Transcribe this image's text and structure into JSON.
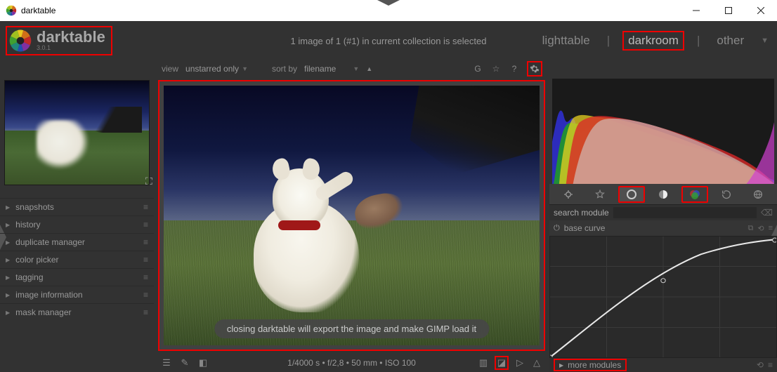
{
  "titlebar": {
    "title": "darktable"
  },
  "brand": {
    "name": "darktable",
    "version": "3.0.1"
  },
  "top": {
    "status": "1 image of 1 (#1) in current collection is selected",
    "nav": {
      "lighttable": "lighttable",
      "darkroom": "darkroom",
      "other": "other"
    }
  },
  "filter": {
    "view_label": "view",
    "view_value": "unstarred only",
    "sort_label": "sort by",
    "sort_value": "filename"
  },
  "left_modules": [
    "snapshots",
    "history",
    "duplicate manager",
    "color picker",
    "tagging",
    "image information",
    "mask manager"
  ],
  "toast": "closing darktable will export the image and make GIMP load it",
  "status_info": "1/4000 s • f/2,8 • 50 mm • ISO 100",
  "search": {
    "label": "search module",
    "placeholder": ""
  },
  "module": {
    "name": "base curve"
  },
  "more": {
    "label": "more modules"
  }
}
